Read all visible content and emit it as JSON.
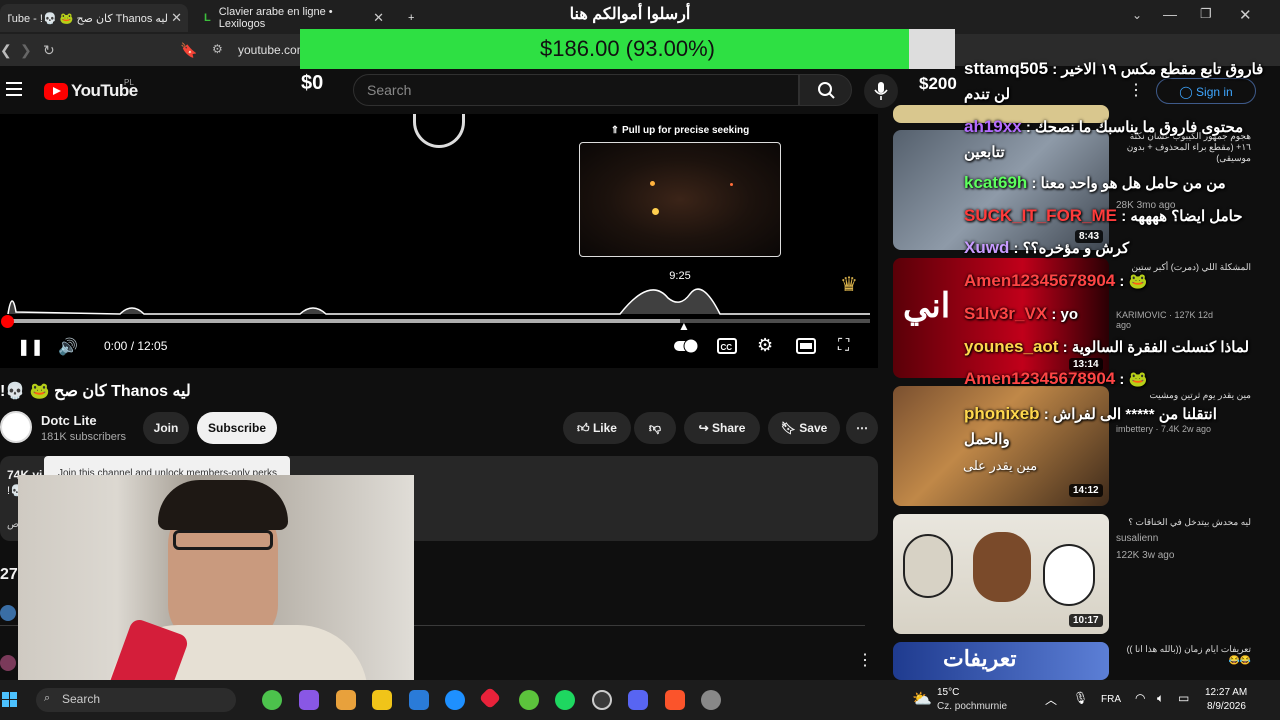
{
  "browser": {
    "tabs": [
      {
        "label": "ليه Thanos كان صح 🐸 💀! - YouTube"
      },
      {
        "label": "Clavier arabe en ligne • Lexilogos"
      }
    ],
    "new_tab": "+",
    "url": "youtube.com"
  },
  "donation": {
    "title": "أرسلوا أموالكم هنا",
    "progress_text": "$186.00 (93.00%)",
    "progress_fraction": 0.93,
    "min_label": "$0",
    "max_label": "$200",
    "fill_color": "#2ee043"
  },
  "youtube": {
    "logo_text": "YouTube",
    "country": "PL",
    "search_placeholder": "Search",
    "sign_in": "Sign in"
  },
  "player": {
    "pull_up_hint": "⇑ Pull up for precise seeking",
    "hover_time": "9:25",
    "timecode": "0:00 / 12:05",
    "buffer_fraction": 0.78,
    "played_fraction": 0.0
  },
  "video": {
    "title": "ليه Thanos كان صح 🐸 💀!",
    "channel_name": "Dotc Lite",
    "subscribers": "181K subscribers",
    "join": "Join",
    "subscribe": "Subscribe",
    "like": "Like",
    "share": "Share",
    "save": "Save",
    "tooltip": "Join this channel and unlock members-only perks",
    "views": "74K vi",
    "desc_line2": "!💀",
    "desc_line3": "ص",
    "comments_count": "27"
  },
  "recommendations": [
    {
      "title": "هجوم جمهور الكيبوب عشان نكتة ١٦+ (مقطع براء المحذوف + بدون موسيقى)",
      "meta": "28K  3mo ago",
      "duration": "8:43"
    },
    {
      "title": "المشكلة اللي (دمرت) أكبر ستين",
      "meta": "KARIMOVIC · 127K 12d ago",
      "duration": "13:14",
      "thumb_text": "اني"
    },
    {
      "title": "مين يقدر يوم ثرتين ومشيت",
      "meta": "imbettery · 7.4K 2w ago",
      "duration": "14:12",
      "thumb_text": "مين يقدر على"
    },
    {
      "title": "ليه محدش بيتدخل في الخناقات ؟",
      "channel": "susalienn",
      "meta": "122K  3w ago",
      "duration": "10:17"
    },
    {
      "title": "تعريفات ايام زمان ((بالله هذا انا )) 😂😂",
      "thumb_text": "تعريفات"
    }
  ],
  "chat": [
    {
      "user": "sttamq505",
      "text": "فاروق تابع مقطع مكس ١٩ الاخير لن تندم",
      "color": "#ffffff"
    },
    {
      "user": "ah19xx",
      "text": "محتوى فاروق ما يناسبك ما نصحك تتابعين",
      "color": "#b46cff"
    },
    {
      "user": "kcat69h",
      "text": "من من حامل هل هو واحد معنا",
      "color": "#5dff5d"
    },
    {
      "user": "SUCK_IT_FOR_ME",
      "text": "حامل ايضا؟ ههههه",
      "color": "#ff3b3b"
    },
    {
      "user": "Xuwd",
      "text": "كرش و مؤخره؟؟",
      "color": "#c89bff"
    },
    {
      "user": "Amen12345678904",
      "text": "🐸",
      "color": "#ff4545"
    },
    {
      "user": "S1lv3r_VX",
      "text": "yo",
      "color": "#ff4545"
    },
    {
      "user": "younes_aot",
      "text": "لماذا كنسلت الفقرة السالوية",
      "color": "#ffd84d"
    },
    {
      "user": "Amen12345678904",
      "text": "🐸",
      "color": "#ff4545"
    },
    {
      "user": "phonixeb",
      "text": "انتقلنا من ***** الى لفراش والحمل",
      "color": "#ffd84d"
    }
  ],
  "taskbar": {
    "search": "Search",
    "weather_temp": "15°C",
    "weather_desc": "Cz. pochmurnie",
    "lang": "FRA",
    "time": "12:27 AM",
    "date": "8/9/2026"
  },
  "colors": {
    "youtube_red": "#ff0000",
    "background": "#0f0f0f",
    "link_blue": "#3ea6ff"
  }
}
